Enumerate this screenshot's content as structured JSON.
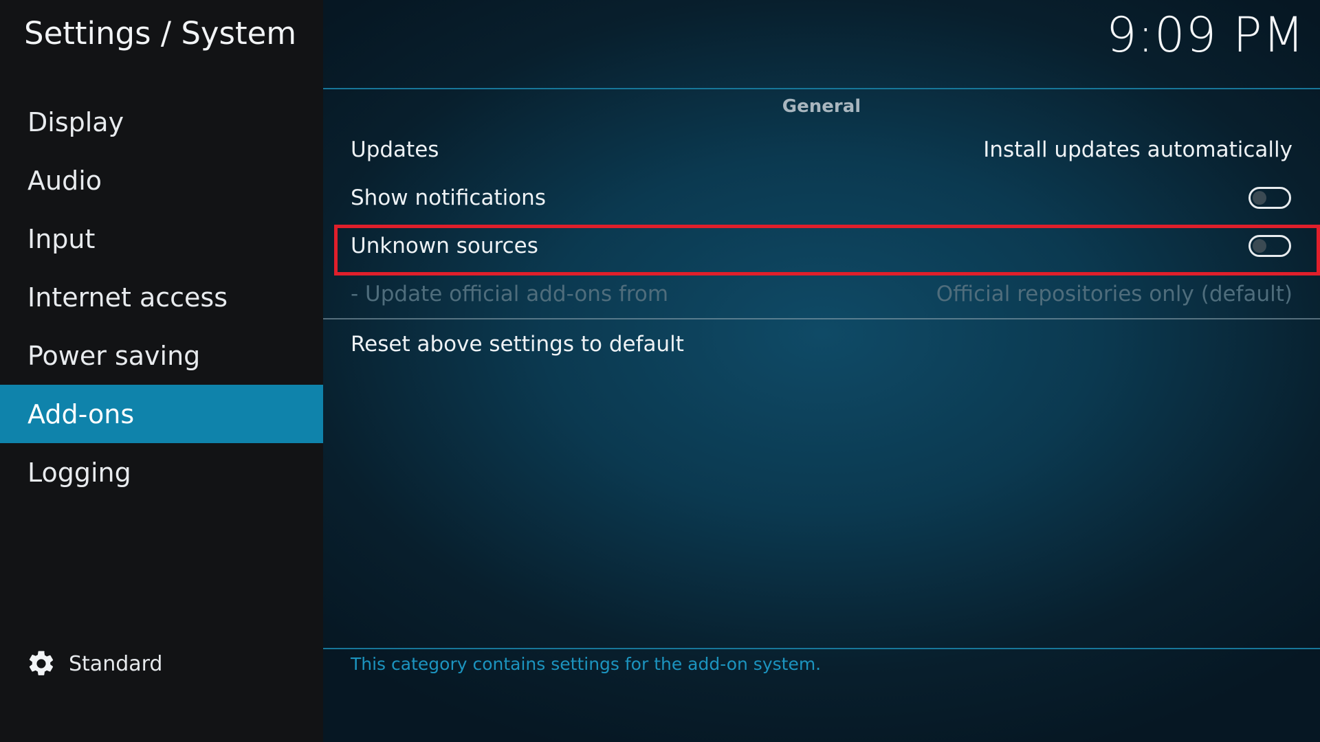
{
  "header": {
    "breadcrumb": "Settings / System",
    "clock": "9:09 PM"
  },
  "sidebar": {
    "items": [
      {
        "label": "Display"
      },
      {
        "label": "Audio"
      },
      {
        "label": "Input"
      },
      {
        "label": "Internet access"
      },
      {
        "label": "Power saving"
      },
      {
        "label": "Add-ons",
        "active": true
      },
      {
        "label": "Logging"
      }
    ],
    "mode": {
      "icon": "gear-icon",
      "label": "Standard"
    }
  },
  "main": {
    "section_title": "General",
    "settings": {
      "updates": {
        "label": "Updates",
        "value": "Install updates automatically"
      },
      "show_notifications": {
        "label": "Show notifications",
        "enabled": false
      },
      "unknown_sources": {
        "label": "Unknown sources",
        "enabled": false,
        "highlighted": true
      },
      "update_official": {
        "label": "- Update official add-ons from",
        "value": "Official repositories only (default)",
        "disabled": true
      }
    },
    "reset_label": "Reset above settings to default",
    "description": "This category contains settings for the add-on system."
  },
  "colors": {
    "accent": "#0f83ab",
    "highlight_border": "#e01f2b",
    "description_text": "#1c94bf",
    "sidebar_bg": "#121315"
  }
}
